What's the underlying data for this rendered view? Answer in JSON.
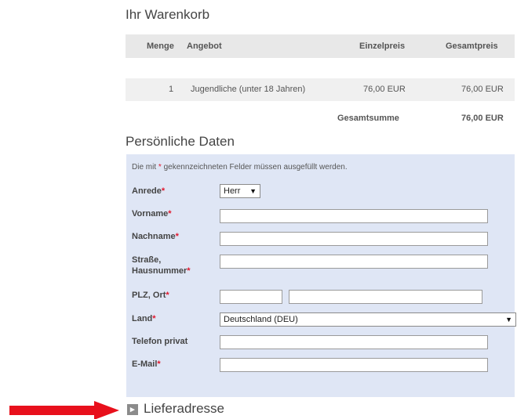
{
  "cart": {
    "title": "Ihr Warenkorb",
    "headers": {
      "qty": "Menge",
      "offer": "Angebot",
      "unit_price": "Einzelpreis",
      "total_price": "Gesamtpreis"
    },
    "rows": [
      {
        "qty": "1",
        "offer": "Jugendliche (unter 18 Jahren)",
        "unit_price": "76,00 EUR",
        "total_price": "76,00 EUR"
      }
    ],
    "total_label": "Gesamtsumme",
    "total_value": "76,00 EUR"
  },
  "personal": {
    "title": "Persönliche Daten",
    "note_before": "Die mit ",
    "note_star": "*",
    "note_after": " gekennzeichneten Felder müssen ausgefüllt werden.",
    "required_mark": "*",
    "fields": {
      "salutation_label": "Anrede",
      "salutation_value": "Herr",
      "firstname_label": "Vorname",
      "lastname_label": "Nachname",
      "street_label_1": "Straße,",
      "street_label_2": "Hausnummer",
      "zip_city_label": "PLZ, Ort",
      "country_label": "Land",
      "country_value": "Deutschland (DEU)",
      "phone_label": "Telefon privat",
      "email_label": "E-Mail"
    },
    "select_arrow": "▼"
  },
  "delivery": {
    "title": "Lieferadresse",
    "expand_glyph": "▸"
  },
  "colors": {
    "required": "#e0182e",
    "panel_bg": "#dfe6f5",
    "annotation_arrow": "#e8101c"
  }
}
